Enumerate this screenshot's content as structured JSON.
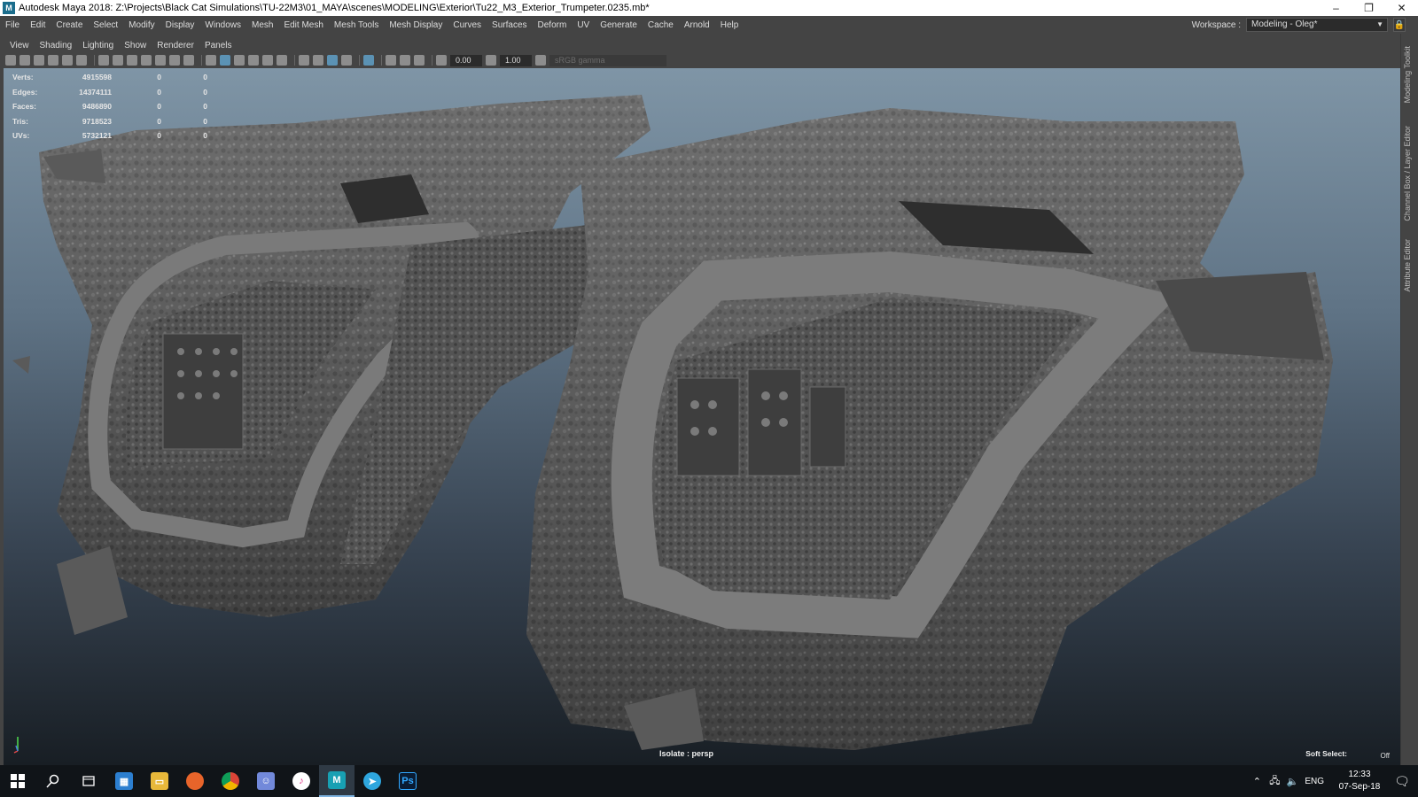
{
  "window": {
    "title": "Autodesk Maya 2018: Z:\\Projects\\Black Cat Simulations\\TU-22M3\\01_MAYA\\scenes\\MODELING\\Exterior\\Tu22_M3_Exterior_Trumpeter.0235.mb*",
    "app_icon": "M",
    "minimize": "–",
    "restore": "❐",
    "close": "✕"
  },
  "menubar": {
    "items": [
      "File",
      "Edit",
      "Create",
      "Select",
      "Modify",
      "Display",
      "Windows",
      "Mesh",
      "Edit Mesh",
      "Mesh Tools",
      "Mesh Display",
      "Curves",
      "Surfaces",
      "Deform",
      "UV",
      "Generate",
      "Cache",
      "Arnold",
      "Help"
    ],
    "workspace_label": "Workspace :",
    "workspace_value": "Modeling - Oleg*"
  },
  "panel_menu": {
    "items": [
      "View",
      "Shading",
      "Lighting",
      "Show",
      "Renderer",
      "Panels"
    ]
  },
  "toolbar": {
    "exposure": "0.00",
    "gamma": "1.00",
    "colorspace": "sRGB gamma"
  },
  "hud": {
    "rows": [
      {
        "label": "Verts:",
        "value": "4915598",
        "sel": "0",
        "comp": "0"
      },
      {
        "label": "Edges:",
        "value": "14374111",
        "sel": "0",
        "comp": "0"
      },
      {
        "label": "Faces:",
        "value": "9486890",
        "sel": "0",
        "comp": "0"
      },
      {
        "label": "Tris:",
        "value": "9718523",
        "sel": "0",
        "comp": "0"
      },
      {
        "label": "UVs:",
        "value": "5732121",
        "sel": "0",
        "comp": "0"
      }
    ]
  },
  "viewport": {
    "camera_label": "Isolate : persp",
    "soft_select_label": "Soft Select:",
    "soft_select_value": "Off"
  },
  "right_dock": {
    "tabs": [
      "Modeling Toolkit",
      "Channel Box / Layer Editor",
      "Attribute Editor"
    ]
  },
  "taskbar": {
    "language": "ENG",
    "time": "12:33",
    "date": "07-Sep-18",
    "apps": [
      "Explorer",
      "Files",
      "Firefox",
      "Chrome",
      "Discord",
      "iTunes",
      "Maya",
      "Telegram",
      "Photoshop"
    ],
    "maya_letter": "M",
    "photoshop_letter": "Ps"
  },
  "colors": {
    "maya_ui": "#444444",
    "viewport_top": "#7f95a6",
    "viewport_bottom": "#181e24",
    "taskbar": "#101418"
  }
}
